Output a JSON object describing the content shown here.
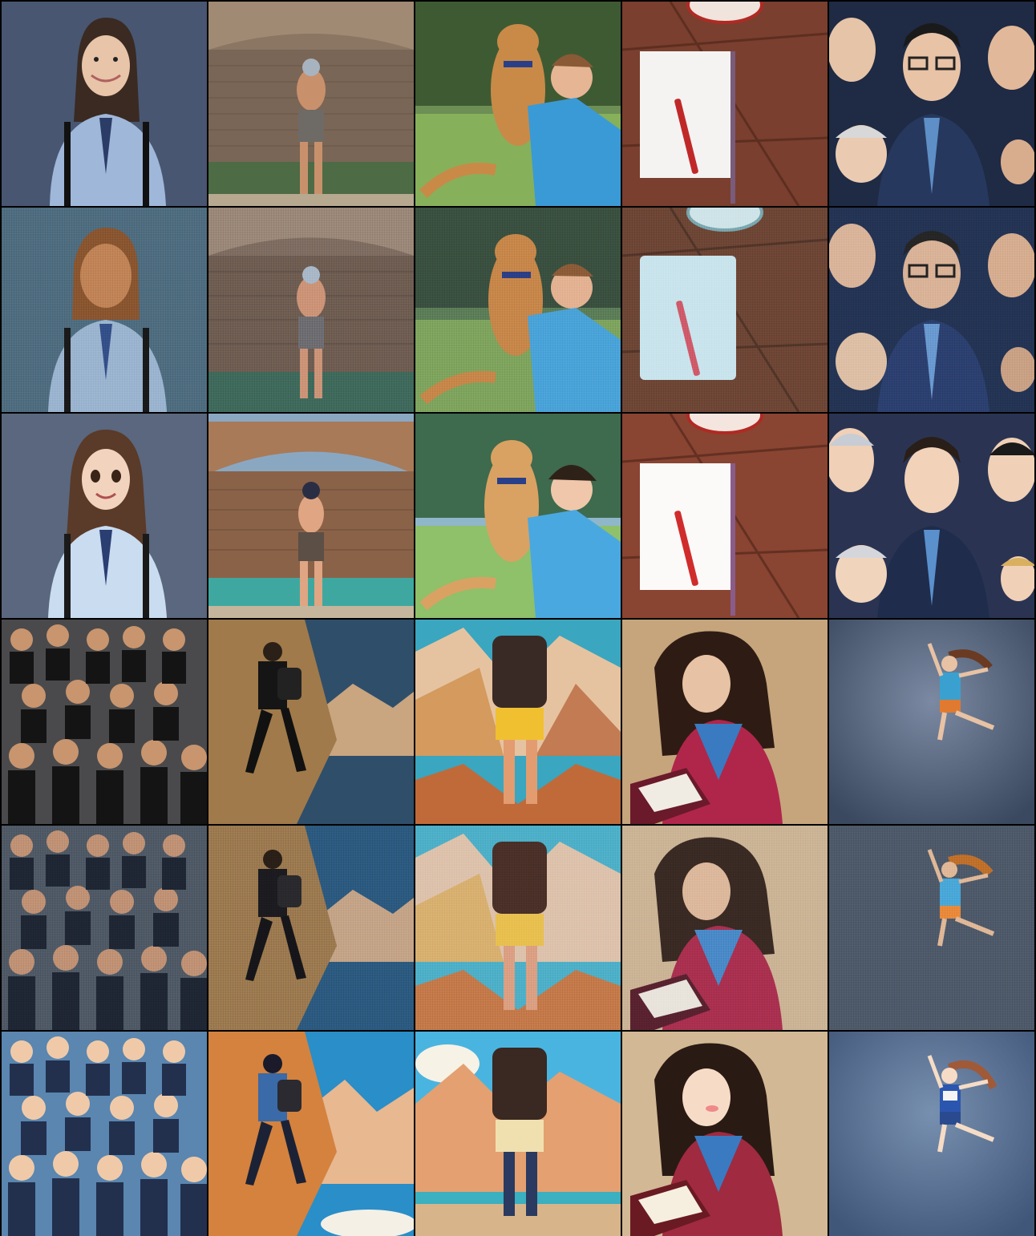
{
  "grid": {
    "rows": 6,
    "cols": 5,
    "row_groups": [
      {
        "variants": [
          "original",
          "reconstruction",
          "anime-style"
        ]
      },
      {
        "variants": [
          "original",
          "reconstruction",
          "anime-style"
        ]
      }
    ],
    "subjects_group1": [
      "girl-in-school-uniform",
      "man-at-stone-ruins",
      "boy-hugging-puppy",
      "notebook-and-pen",
      "cartoon-businessmen"
    ],
    "subjects_group2": [
      "group-of-women",
      "rock-climber",
      "backpacker-mountains",
      "girl-reading-book",
      "jumping-girl"
    ]
  }
}
